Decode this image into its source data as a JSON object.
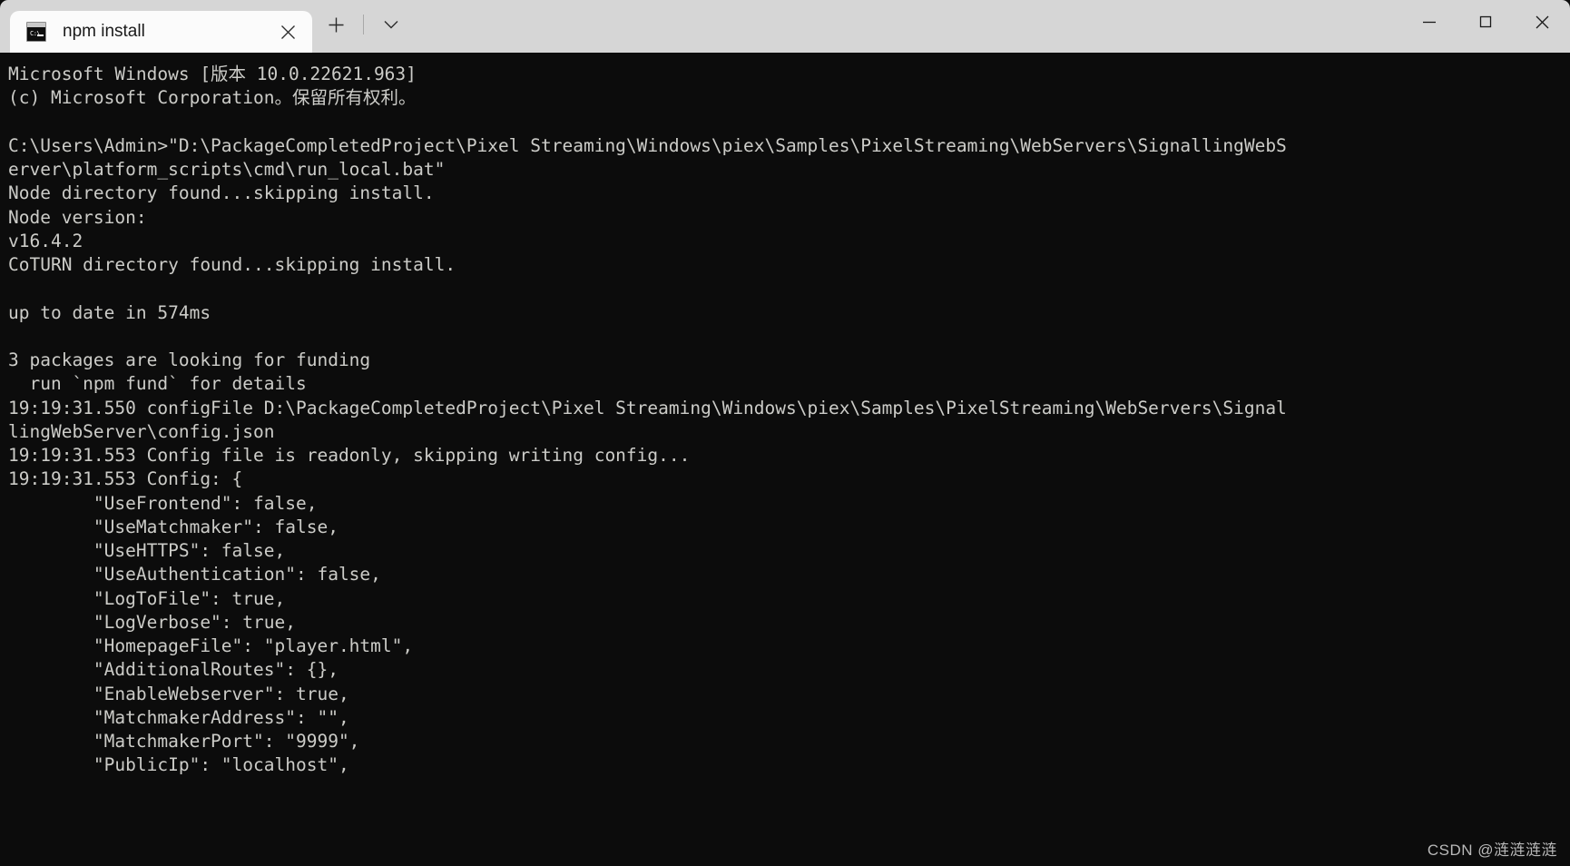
{
  "window": {
    "tab": {
      "title": "npm install",
      "icon": "console-icon",
      "icon_prompt": "C:\\",
      "close_icon": "close-icon"
    },
    "new_tab_icon": "plus-icon",
    "tab_dropdown_icon": "chevron-down-icon",
    "controls": {
      "minimize": "minimize-icon",
      "maximize": "maximize-icon",
      "close": "close-icon"
    }
  },
  "terminal": {
    "background_color": "#0c0c0c",
    "text_color": "#ccccc8",
    "content": "Microsoft Windows [版本 10.0.22621.963]\n(c) Microsoft Corporation。保留所有权利。\n\nC:\\Users\\Admin>\"D:\\PackageCompletedProject\\Pixel Streaming\\Windows\\piex\\Samples\\PixelStreaming\\WebServers\\SignallingWebS\nerver\\platform_scripts\\cmd\\run_local.bat\"\nNode directory found...skipping install.\nNode version:\nv16.4.2\nCoTURN directory found...skipping install.\n\nup to date in 574ms\n\n3 packages are looking for funding\n  run `npm fund` for details\n19:19:31.550 configFile D:\\PackageCompletedProject\\Pixel Streaming\\Windows\\piex\\Samples\\PixelStreaming\\WebServers\\Signal\nlingWebServer\\config.json\n19:19:31.553 Config file is readonly, skipping writing config...\n19:19:31.553 Config: {\n        \"UseFrontend\": false,\n        \"UseMatchmaker\": false,\n        \"UseHTTPS\": false,\n        \"UseAuthentication\": false,\n        \"LogToFile\": true,\n        \"LogVerbose\": true,\n        \"HomepageFile\": \"player.html\",\n        \"AdditionalRoutes\": {},\n        \"EnableWebserver\": true,\n        \"MatchmakerAddress\": \"\",\n        \"MatchmakerPort\": \"9999\",\n        \"PublicIp\": \"localhost\","
  },
  "watermark": {
    "text": "CSDN @涟涟涟涟"
  }
}
